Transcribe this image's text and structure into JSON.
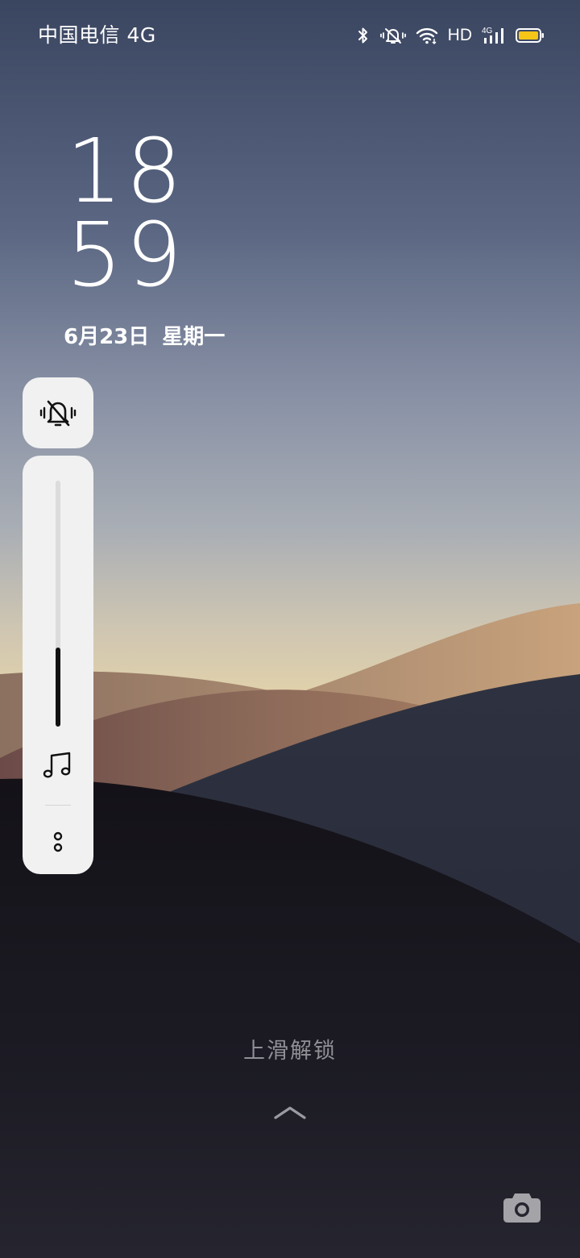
{
  "status_bar": {
    "carrier": "中国电信 4G",
    "hd_label": "HD",
    "network_badge": "4G",
    "icons": [
      "bluetooth-icon",
      "vibrate-silent-icon",
      "wifi-icon",
      "hd-label",
      "cellular-signal-icon",
      "battery-icon"
    ],
    "battery_color": "#f5c518"
  },
  "lock_screen": {
    "hour": "18",
    "minute": "59",
    "date": "6月23日",
    "weekday": "星期一"
  },
  "volume_panel": {
    "ringer_mode_icon": "vibrate-silent-icon",
    "level": 0.32,
    "stream_icon": "music-note-icon",
    "more_icon": "more-options-icon"
  },
  "bottom": {
    "unlock_hint": "上滑解锁",
    "chevron_icon": "chevron-up-icon",
    "camera_icon": "camera-icon"
  }
}
